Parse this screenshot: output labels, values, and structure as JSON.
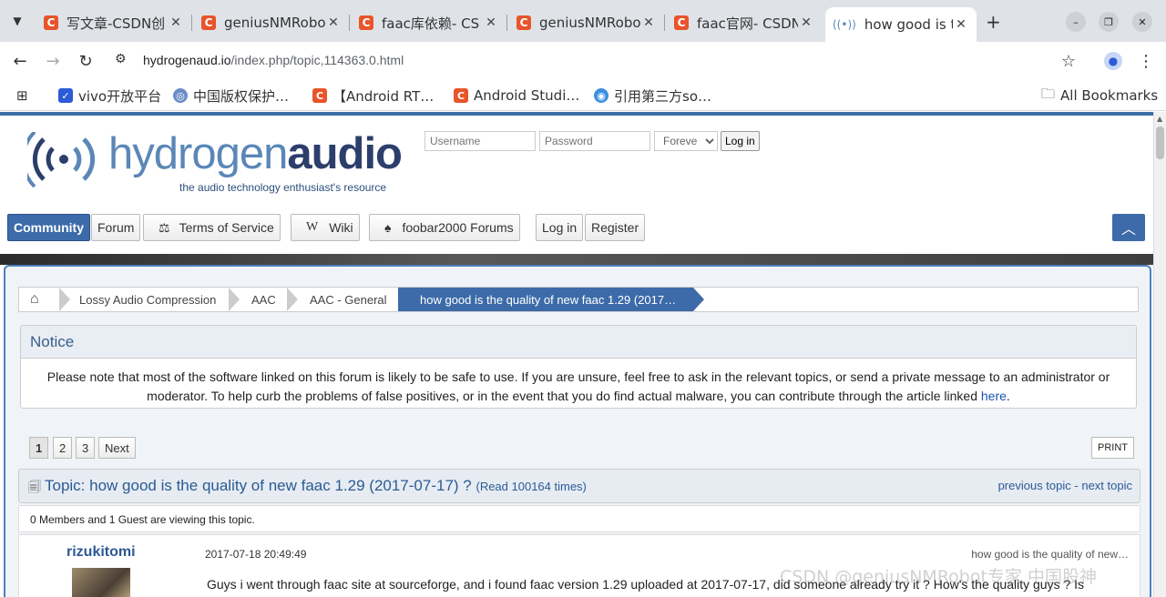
{
  "tabs": [
    {
      "title": "写文章-CSDN创",
      "icon": "C"
    },
    {
      "title": "geniusNMRobo",
      "icon": "C"
    },
    {
      "title": "faac库依赖- CS",
      "icon": "C"
    },
    {
      "title": "geniusNMRobo",
      "icon": "C"
    },
    {
      "title": "faac官网- CSDN",
      "icon": "C"
    },
    {
      "title": "how good is the",
      "icon": "wave"
    }
  ],
  "address": {
    "host": "hydrogenaud.io",
    "path": "/index.php/topic,114363.0.html"
  },
  "bookmarks": [
    {
      "label": "vivo开放平台",
      "color": "#2b5bd7"
    },
    {
      "label": "中国版权保护…",
      "color": "#6b8ec9"
    },
    {
      "label": "【Android RT…",
      "color": "#e8542b"
    },
    {
      "label": "Android Studi…",
      "color": "#e8542b"
    },
    {
      "label": "引用第三方so…",
      "color": "#3c8fe0"
    }
  ],
  "all_bookmarks": "All Bookmarks",
  "site": {
    "logo_light": "hydrogen",
    "logo_bold": "audio",
    "tagline": "the audio technology enthusiast's resource",
    "username_ph": "Username",
    "password_ph": "Password",
    "remember": "Forever",
    "login_btn": "Log in",
    "menu": [
      "Community",
      "Forum",
      "Terms of Service",
      "Wiki",
      "foobar2000 Forums",
      "Log in",
      "Register"
    ]
  },
  "breadcrumbs": [
    "Lossy Audio Compression",
    "AAC",
    "AAC - General",
    "how good is the quality of new faac 1.29 (2017…"
  ],
  "notice": {
    "title": "Notice",
    "text": "Please note that most of the software linked on this forum is likely to be safe to use. If you are unsure, feel free to ask in the relevant topics, or send a private message to an administrator or moderator. To help curb the problems of false positives, or in the event that you do find actual malware, you can contribute through the article linked ",
    "link": "here",
    "tail": "."
  },
  "pagination": [
    "1",
    "2",
    "3",
    "Next"
  ],
  "print": "PRINT",
  "topic": {
    "label": "Topic: how good is the quality of new faac 1.29 (2017-07-17) ?",
    "reads": "(Read 100164 times)",
    "prev": "previous topic",
    "dash": " - ",
    "next": "next topic",
    "viewing": "0 Members and 1 Guest are viewing this topic."
  },
  "post": {
    "author": "rizukitomi",
    "date": "2017-07-18 20:49:49",
    "subject": "how good is the quality of new…",
    "body": "Guys i went through faac site at sourceforge, and i found faac version 1.29 uploaded at 2017-07-17, did someone already try it ? How's the quality guys ? Is"
  },
  "watermark": "CSDN @geniusNMRobot专家  中国股神"
}
